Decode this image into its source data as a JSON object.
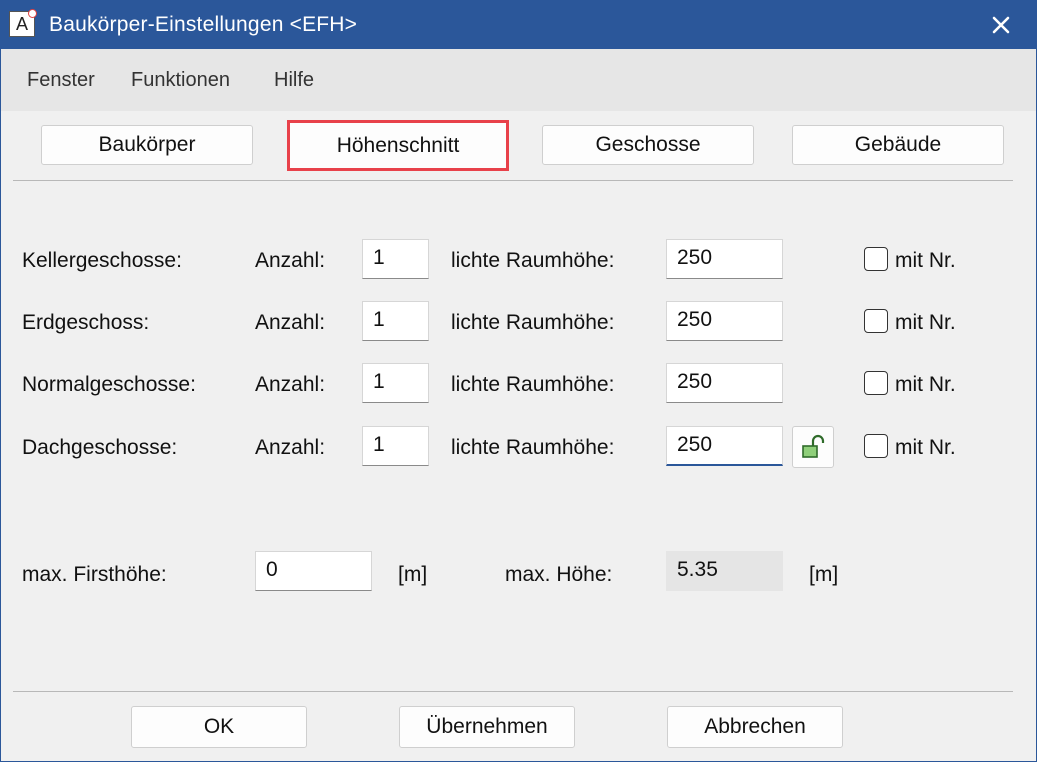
{
  "window": {
    "title": "Baukörper-Einstellungen <EFH>",
    "app_icon_letter": "A"
  },
  "menu": {
    "items": [
      "Fenster",
      "Funktionen",
      "Hilfe"
    ]
  },
  "tabs": [
    {
      "label": "Baukörper"
    },
    {
      "label": "Höhenschnitt",
      "highlighted": true
    },
    {
      "label": "Geschosse"
    },
    {
      "label": "Gebäude"
    }
  ],
  "rows": [
    {
      "label": "Kellergeschosse:",
      "count_label": "Anzahl:",
      "count": "1",
      "height_label": "lichte Raumhöhe:",
      "height": "250",
      "checkbox_label": "mit Nr."
    },
    {
      "label": "Erdgeschoss:",
      "count_label": "Anzahl:",
      "count": "1",
      "height_label": "lichte Raumhöhe:",
      "height": "250",
      "checkbox_label": "mit Nr."
    },
    {
      "label": "Normalgeschosse:",
      "count_label": "Anzahl:",
      "count": "1",
      "height_label": "lichte Raumhöhe:",
      "height": "250",
      "checkbox_label": "mit Nr."
    },
    {
      "label": "Dachgeschosse:",
      "count_label": "Anzahl:",
      "count": "1",
      "height_label": "lichte Raumhöhe:",
      "height": "250",
      "checkbox_label": "mit Nr."
    }
  ],
  "heights": {
    "ridge_label": "max. Firsthöhe:",
    "ridge_value": "0",
    "ridge_unit": "[m]",
    "max_label": "max. Höhe:",
    "max_value": "5.35",
    "max_unit": "[m]"
  },
  "buttons": {
    "ok": "OK",
    "apply": "Übernehmen",
    "cancel": "Abbrechen"
  },
  "colors": {
    "titlebar": "#2b579a",
    "highlight": "#e8414a",
    "lock": "#8fcf7a"
  }
}
